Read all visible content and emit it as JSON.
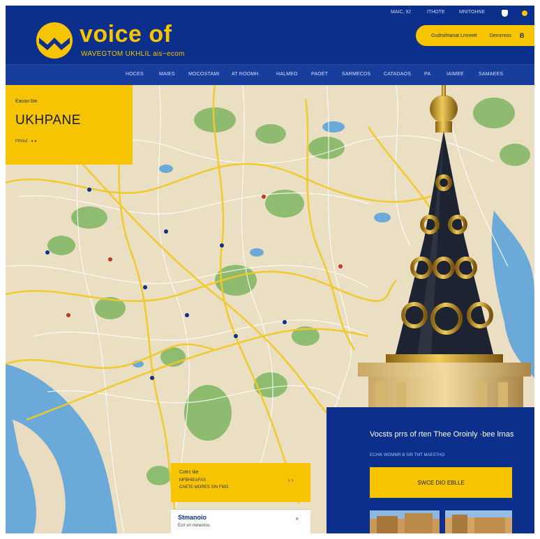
{
  "header": {
    "brand_title": "voice of",
    "brand_subtitle": "WAVEGTOM UKHLIL ais~ecom",
    "util_links": [
      "MAIC, 92",
      "ITHOTE",
      "MNITOHNE"
    ],
    "cta": {
      "left_text": "Gudrsihtanat Lmreett",
      "right_text": "Dernrreos",
      "icon_letter": "B"
    },
    "accent_color": "#f6c400",
    "brand_color": "#0b2f8a"
  },
  "nav": {
    "items": [
      "HOCES",
      "MAIES",
      "MOCOSTAMI",
      "AT ROOMH",
      "HALMEO",
      "PAOET",
      "SARMECDS",
      "CATADAOS",
      "PA",
      "IAIMEE",
      "SAMAEES"
    ]
  },
  "hero": {
    "kicker": "Eaoan bie",
    "title": "UKHPANE",
    "meta": "Pfhfed · ♦ ♦"
  },
  "card_yellow": {
    "title": "Cotrc tiie",
    "line1": "MFBHIEAFAS",
    "line2": "CAETE MORES SIN FMO"
  },
  "card_white": {
    "title": "Stmanoio",
    "subtitle": "Ecrt vrr mmemos"
  },
  "panel": {
    "title": "Vocsts prrs of rten Thee Oroinly ·bee lrnas",
    "subtitle": "ECHIK WOMMR B SIR TMT MAESTHO",
    "button_label": "SWCE DIO EBLLE"
  }
}
